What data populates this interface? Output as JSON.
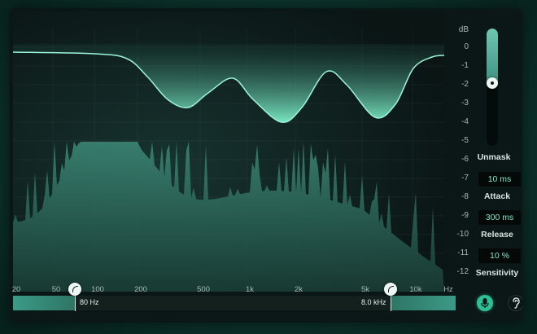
{
  "app": {
    "accent_color": "#6fe0bf",
    "background_color": "#0b1716",
    "display_fill_color": "#2f7a6a"
  },
  "db_scale": {
    "unit": "dB",
    "ticks": [
      "0",
      "-1",
      "-2",
      "-3",
      "-4",
      "-5",
      "-6",
      "-7",
      "-8",
      "-9",
      "-10",
      "-11",
      "-12"
    ]
  },
  "freq_scale": {
    "ticks": [
      "20",
      "50",
      "100",
      "200",
      "500",
      "1k",
      "2k",
      "5k",
      "10k",
      "Hz"
    ]
  },
  "low_cut": {
    "value": "80 Hz"
  },
  "high_cut": {
    "value": "8.0 kHz"
  },
  "controls": {
    "unmask": {
      "label": "Unmask",
      "level_percent": 47
    },
    "attack": {
      "label": "Attack",
      "value": "10 ms"
    },
    "release": {
      "label": "Release",
      "value": "300 ms"
    },
    "sensitivity": {
      "label": "Sensitivity",
      "value": "10 %"
    }
  },
  "buttons": {
    "mic": {
      "icon": "microphone-icon",
      "active": true
    },
    "ear": {
      "icon": "ear-icon",
      "active": false
    }
  }
}
